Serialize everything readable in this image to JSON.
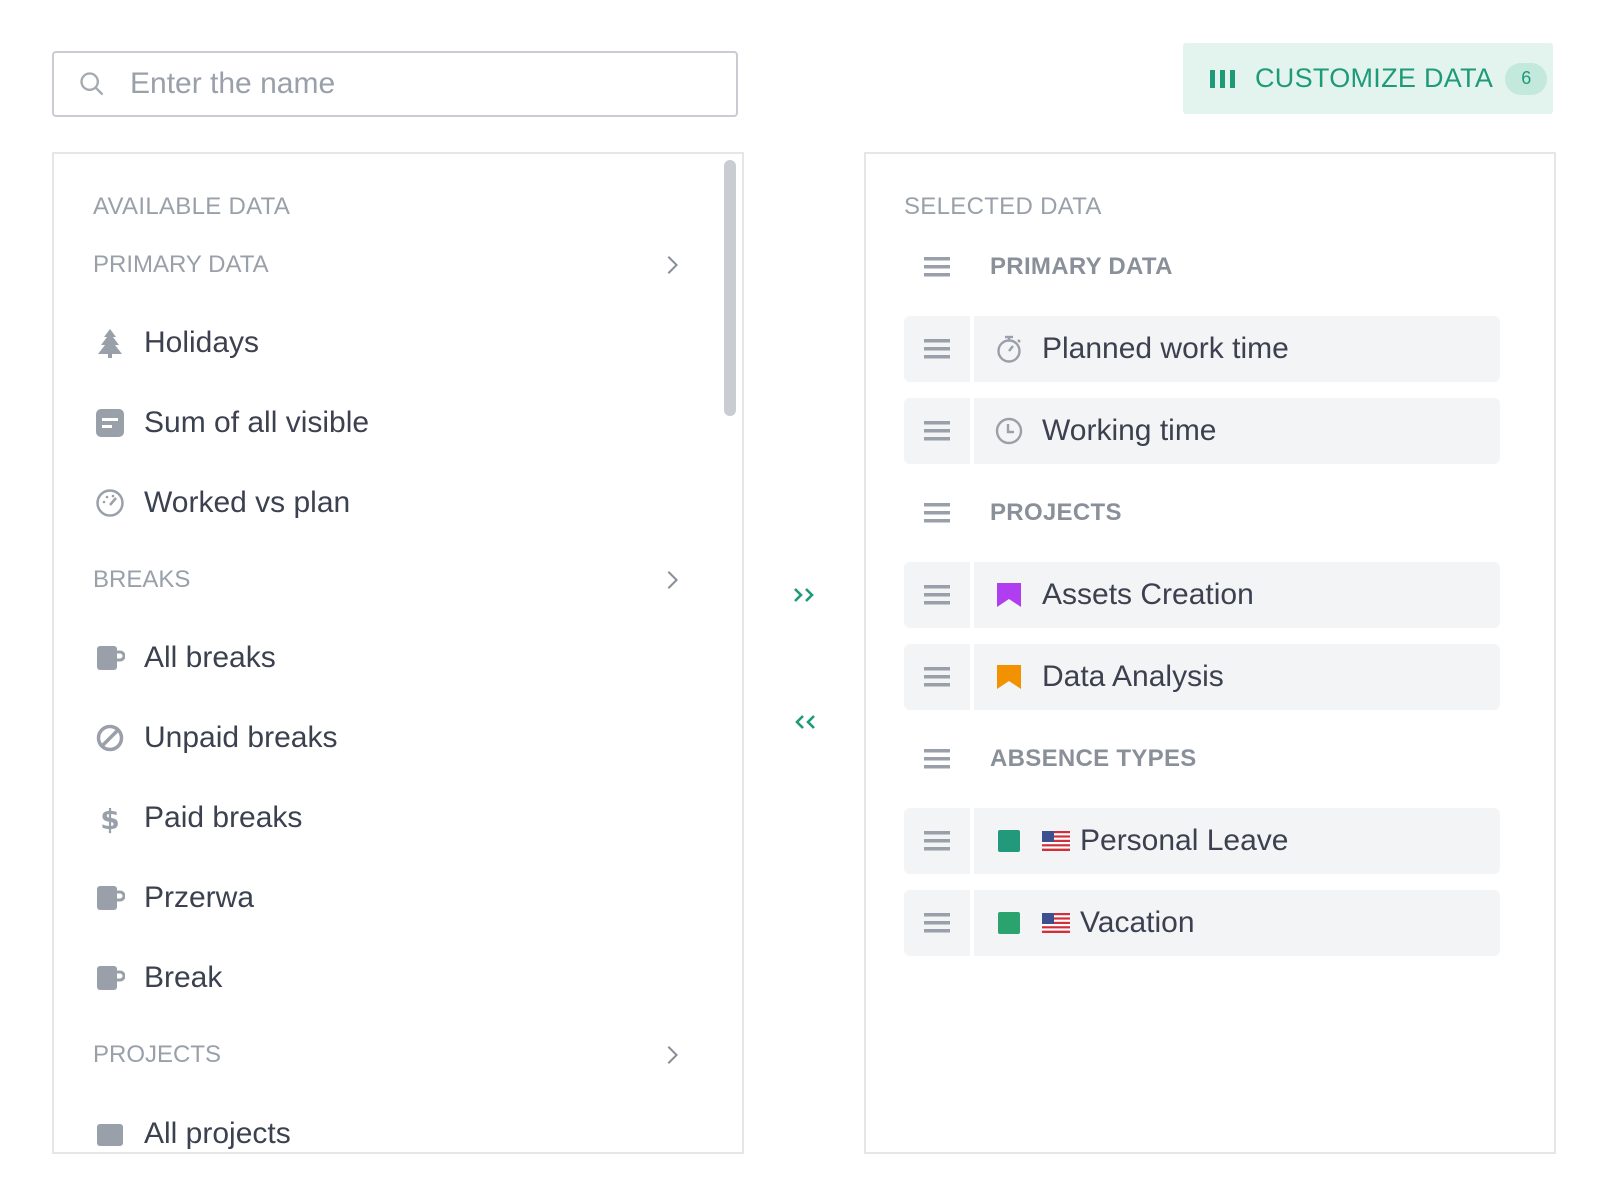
{
  "search": {
    "placeholder": "Enter the name"
  },
  "customize": {
    "label": "CUSTOMIZE DATA",
    "count": "6",
    "accent": "#1f9a78"
  },
  "available": {
    "heading": "AVAILABLE DATA",
    "sections": [
      {
        "label": "PRIMARY DATA",
        "items": [
          {
            "label": "Holidays",
            "icon": "tree-icon"
          },
          {
            "label": "Sum of all visible",
            "icon": "note-icon"
          },
          {
            "label": "Worked vs plan",
            "icon": "gauge-icon"
          }
        ]
      },
      {
        "label": "BREAKS",
        "items": [
          {
            "label": "All breaks",
            "icon": "mug-icon"
          },
          {
            "label": "Unpaid breaks",
            "icon": "no-icon"
          },
          {
            "label": "Paid breaks",
            "icon": "dollar-icon"
          },
          {
            "label": "Przerwa",
            "icon": "mug-icon"
          },
          {
            "label": "Break",
            "icon": "mug-icon"
          }
        ]
      },
      {
        "label": "PROJECTS",
        "items": [
          {
            "label": "All projects",
            "icon": "folder-icon"
          }
        ]
      }
    ]
  },
  "transfer": {
    "add": "››",
    "remove": "‹‹"
  },
  "selected": {
    "heading": "SELECTED DATA",
    "groups": [
      {
        "label": "PRIMARY DATA",
        "items": [
          {
            "label": "Planned work time",
            "icon": "stopwatch-icon"
          },
          {
            "label": "Working time",
            "icon": "clock-icon"
          }
        ]
      },
      {
        "label": "PROJECTS",
        "items": [
          {
            "label": "Assets Creation",
            "icon": "bookmark-icon",
            "color": "#b03ef0"
          },
          {
            "label": "Data Analysis",
            "icon": "bookmark-icon",
            "color": "#f39200"
          }
        ]
      },
      {
        "label": "ABSENCE TYPES",
        "items": [
          {
            "label": "Personal Leave",
            "icon": "square-icon",
            "color": "#23997b",
            "flag": "us-flag-icon"
          },
          {
            "label": "Vacation",
            "icon": "square-icon",
            "color": "#2aa36e",
            "flag": "us-flag-icon"
          }
        ]
      }
    ]
  }
}
